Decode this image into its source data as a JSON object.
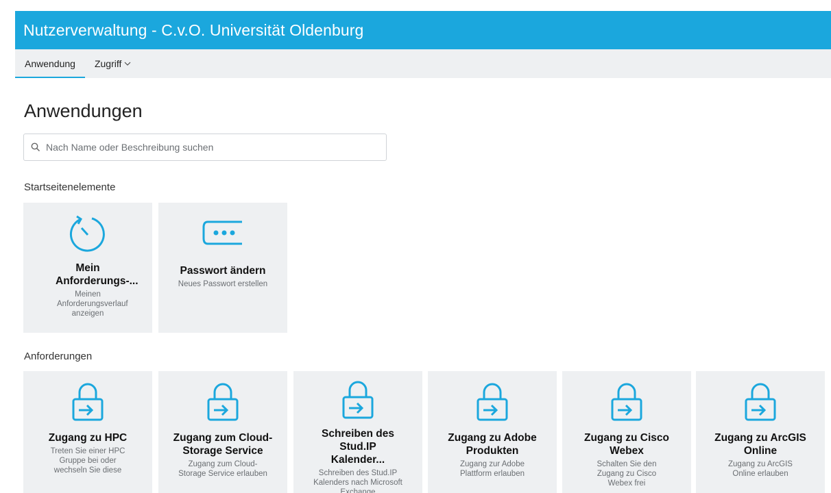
{
  "header": {
    "title": "Nutzerverwaltung - C.v.O. Universität Oldenburg"
  },
  "tabs": [
    {
      "label": "Anwendung"
    },
    {
      "label": "Zugriff"
    }
  ],
  "page": {
    "title": "Anwendungen"
  },
  "search": {
    "placeholder": "Nach Name oder Beschreibung suchen"
  },
  "sections": {
    "home": "Startseitenelemente",
    "requests": "Anforderungen"
  },
  "home_tiles": [
    {
      "title": "Mein Anforderungs-...",
      "description": "Meinen Anforderungsverlauf anzeigen",
      "icon": "history-icon"
    },
    {
      "title": "Passwort ändern",
      "description": "Neues Passwort erstellen",
      "icon": "password-icon"
    }
  ],
  "request_tiles": [
    {
      "title": "Zugang zu HPC",
      "description": "Treten Sie einer HPC Gruppe bei oder wechseln Sie diese",
      "icon": "lock-icon"
    },
    {
      "title": "Zugang zum Cloud-Storage Service",
      "description": "Zugang zum Cloud-Storage Service erlauben",
      "icon": "lock-icon"
    },
    {
      "title": "Schreiben des Stud.IP Kalender...",
      "description": "Schreiben des Stud.IP Kalenders nach Microsoft Exchange",
      "icon": "lock-icon"
    },
    {
      "title": "Zugang zu Adobe Produkten",
      "description": "Zugang zur Adobe Plattform erlauben",
      "icon": "lock-icon"
    },
    {
      "title": "Zugang zu Cisco Webex",
      "description": "Schalten Sie den Zugang zu Cisco Webex frei",
      "icon": "lock-icon"
    },
    {
      "title": "Zugang zu ArcGIS Online",
      "description": "Zugang zu ArcGIS Online erlauben",
      "icon": "lock-icon"
    }
  ],
  "colors": {
    "accent": "#1ba7dd",
    "tile_bg": "#eef0f2"
  }
}
